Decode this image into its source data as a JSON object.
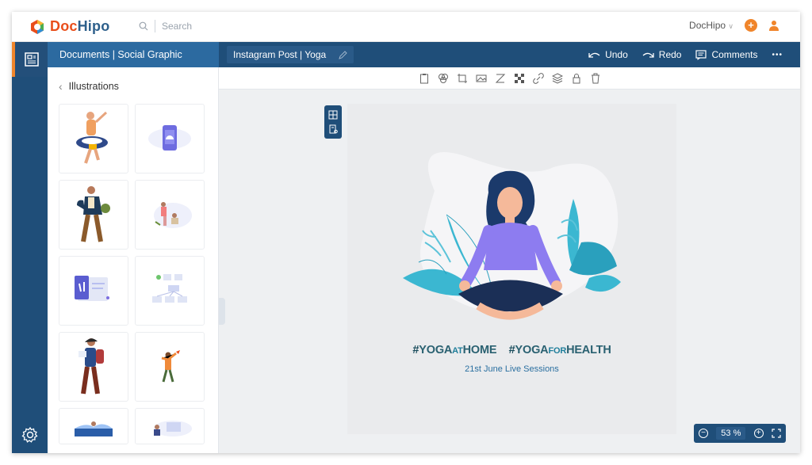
{
  "app": {
    "logo_text_a": "Doc",
    "logo_text_b": "Hipo",
    "search_placeholder": "Search",
    "account_label": "DocHipo",
    "account_chevron": "∨"
  },
  "panel": {
    "header": "Documents | Social Graphic",
    "title": "Illustrations",
    "tiles": [
      {
        "name": "tile-swim-ring-man"
      },
      {
        "name": "tile-android-phone"
      },
      {
        "name": "tile-walking-man"
      },
      {
        "name": "tile-sitting-people"
      },
      {
        "name": "tile-video-screen"
      },
      {
        "name": "tile-flowchart"
      },
      {
        "name": "tile-backpack-reader"
      },
      {
        "name": "tile-dancing-person"
      },
      {
        "name": "tile-landscape"
      },
      {
        "name": "tile-laptop-person"
      }
    ]
  },
  "document": {
    "name": "Instagram Post | Yoga",
    "undo_label": "Undo",
    "redo_label": "Redo",
    "comments_label": "Comments",
    "more_label": "•••"
  },
  "canvas": {
    "hash1": "#",
    "yoga1": "YOGA",
    "at": "AT",
    "home": "HOME",
    "hash2": "#",
    "yoga2": "YOGA",
    "for": "FOR",
    "health": "HEALTH",
    "sessions": "21st June Live Sessions"
  },
  "zoom": {
    "value": "53 %",
    "minus": "−",
    "plus": "+"
  },
  "colors": {
    "brand_dark": "#1f4e79",
    "brand_mid": "#2c6aa0",
    "accent": "#f0852b"
  }
}
